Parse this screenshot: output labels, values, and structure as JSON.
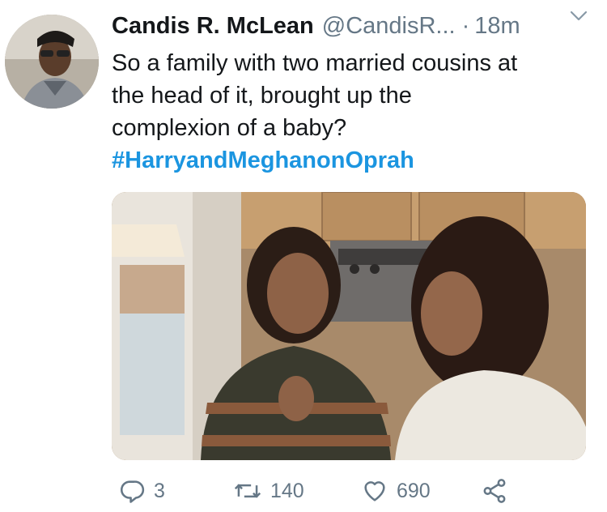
{
  "tweet": {
    "display_name": "Candis R. McLean",
    "handle": "@CandisR...",
    "separator": "·",
    "time": "18m",
    "text_lines": [
      "So a family with two married cousins at",
      "the head of it, brought up the",
      "complexion of a baby?"
    ],
    "hashtag": "#HarryandMeghanonOprah"
  },
  "actions": {
    "reply_count": "3",
    "retweet_count": "140",
    "like_count": "690"
  },
  "colors": {
    "hashtag": "#1b95e0",
    "meta": "#657786",
    "text": "#14171a"
  },
  "icons": [
    "reply-icon",
    "retweet-icon",
    "like-icon",
    "share-icon",
    "chevron-down-icon"
  ]
}
